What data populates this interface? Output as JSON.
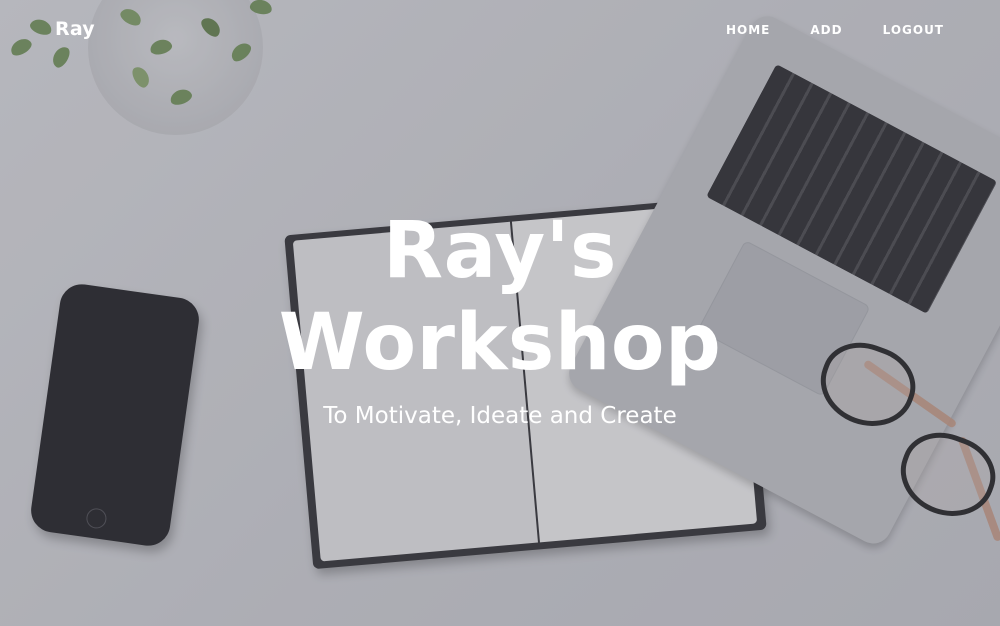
{
  "nav": {
    "brand": "Ray",
    "links": [
      {
        "label": "HOME"
      },
      {
        "label": "ADD"
      },
      {
        "label": "LOGOUT"
      }
    ]
  },
  "hero": {
    "title_line1": "Ray's",
    "title_line2": "Workshop",
    "subtitle": "To Motivate, Ideate and Create"
  },
  "colors": {
    "text": "#ffffff",
    "background": "#cfd0d6"
  }
}
